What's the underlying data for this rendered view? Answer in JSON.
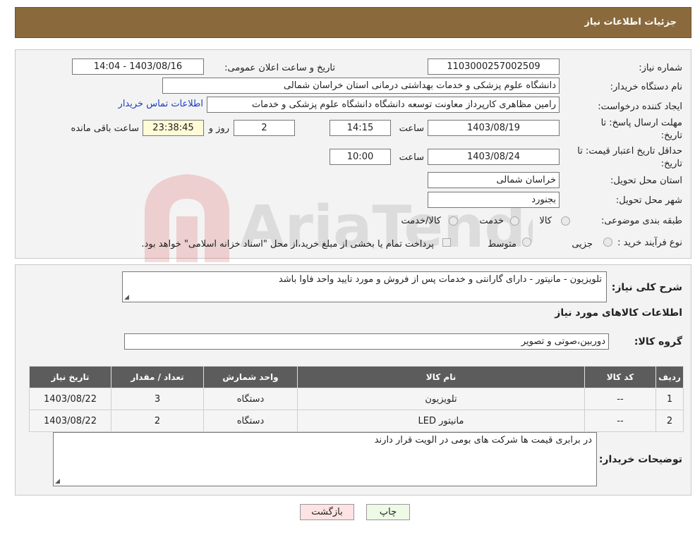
{
  "header": {
    "title": "جزئیات اطلاعات نیاز"
  },
  "form": {
    "need_number_label": "شماره نیاز:",
    "need_number": "1103000257002509",
    "announce_label": "تاریخ و ساعت اعلان عمومی:",
    "announce_value": "1403/08/16 - 14:04",
    "buyer_org_label": "نام دستگاه خریدار:",
    "buyer_org": "دانشگاه علوم پزشکی و خدمات بهداشتی درمانی استان خراسان شمالی",
    "creator_label": "ایجاد کننده درخواست:",
    "creator": "رامین مظاهری کارپرداز معاونت توسعه دانشگاه دانشگاه علوم پزشکی و خدمات",
    "contact_link": "اطلاعات تماس خریدار",
    "deadline_label": "مهلت ارسال پاسخ: تا تاریخ:",
    "deadline_date": "1403/08/19",
    "time_label": "ساعت",
    "deadline_time": "14:15",
    "days": "2",
    "days_label": "روز و",
    "remaining": "23:38:45",
    "remaining_label": "ساعت باقی مانده",
    "validity_label": "حداقل تاریخ اعتبار قیمت: تا تاریخ:",
    "validity_date": "1403/08/24",
    "validity_time": "10:00",
    "province_label": "استان محل تحویل:",
    "province": "خراسان شمالی",
    "city_label": "شهر محل تحویل:",
    "city": "بجنورد",
    "category_label": "طبقه بندی موضوعی:",
    "category_options": [
      "کالا",
      "خدمت",
      "کالا/خدمت"
    ],
    "process_label": "نوع فرآیند خرید :",
    "process_options": [
      "جزیی",
      "متوسط"
    ],
    "payment_note": "پرداخت تمام یا بخشی از مبلغ خرید،از محل \"اسناد خزانه اسلامی\" خواهد بود."
  },
  "details": {
    "summary_label": "شرح کلی نیاز:",
    "summary": "تلویزیون - مانیتور - دارای گارانتی و خدمات پس از فروش و مورد تایید واحد فاوا باشد",
    "goods_info_title": "اطلاعات کالاهای مورد نیاز",
    "goods_group_label": "گروه کالا:",
    "goods_group": "دوربین،صوتی و تصویر",
    "table": {
      "headers": [
        "ردیف",
        "کد کالا",
        "نام کالا",
        "واحد شمارش",
        "تعداد / مقدار",
        "تاریخ نیاز"
      ],
      "rows": [
        [
          "1",
          "--",
          "تلویزیون",
          "دستگاه",
          "3",
          "1403/08/22"
        ],
        [
          "2",
          "--",
          "مانیتور LED",
          "دستگاه",
          "2",
          "1403/08/22"
        ]
      ]
    },
    "buyer_notes_label": "توضیحات خریدار:",
    "buyer_notes": "در برابری قیمت ها شرکت های بومی در الویت قرار دارند"
  },
  "buttons": {
    "print": "چاپ",
    "back": "بازگشت"
  },
  "watermark": {
    "text": "AriaTender.neT"
  },
  "colors": {
    "header": "#8a6a3c",
    "link": "#1a3fbf",
    "table_header": "#5c5c5c",
    "print_btn": "#eef9e6",
    "back_btn": "#fde3e3"
  }
}
